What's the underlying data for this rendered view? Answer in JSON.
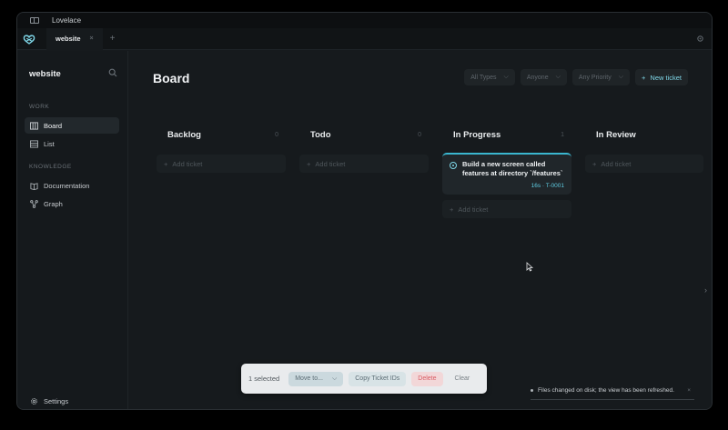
{
  "window": {
    "title": "Lovelace"
  },
  "tabs": [
    {
      "label": "website",
      "close": "×"
    }
  ],
  "add_tab": "+",
  "sidebar": {
    "workspace_name": "website",
    "sections": [
      {
        "label": "WORK",
        "items": [
          {
            "label": "Board",
            "icon": "board-icon",
            "active": true
          },
          {
            "label": "List",
            "icon": "list-icon"
          }
        ]
      },
      {
        "label": "KNOWLEDGE",
        "items": [
          {
            "label": "Documentation",
            "icon": "book-icon"
          },
          {
            "label": "Graph",
            "icon": "graph-icon"
          }
        ]
      }
    ],
    "settings_label": "Settings"
  },
  "board": {
    "title": "Board",
    "filters": [
      {
        "label": "All Types"
      },
      {
        "label": "Anyone"
      },
      {
        "label": "Any Priority"
      }
    ],
    "new_ticket_label": "New ticket",
    "columns": [
      {
        "title": "Backlog",
        "count": "0",
        "add_label": "Add ticket",
        "cards": []
      },
      {
        "title": "Todo",
        "count": "0",
        "add_label": "Add ticket",
        "cards": []
      },
      {
        "title": "In Progress",
        "count": "1",
        "add_label": "Add ticket",
        "cards": [
          {
            "title": "Build a new screen called features at directory `/features`",
            "meta": "16s · T-0001"
          }
        ]
      },
      {
        "title": "In Review",
        "count": "",
        "add_label": "Add ticket",
        "cards": []
      }
    ]
  },
  "actionbar": {
    "selected_text": "1 selected",
    "move_label": "Move to...",
    "copy_label": "Copy Ticket IDs",
    "delete_label": "Delete",
    "clear_label": "Clear"
  },
  "toast": {
    "message": "Files changed on disk; the view has been refreshed.",
    "close": "×"
  },
  "colors": {
    "accent": "#7fd7e8",
    "danger": "#d95c64",
    "background": "#161a1d"
  }
}
